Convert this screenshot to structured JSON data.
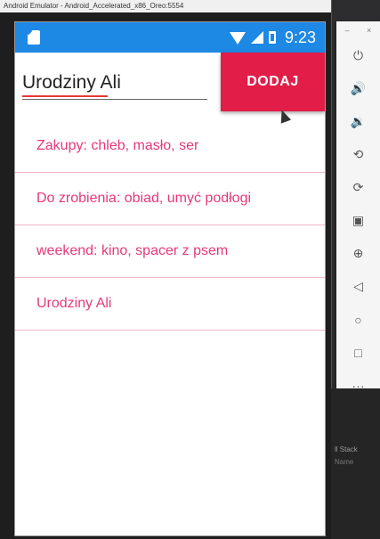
{
  "emulator": {
    "title": "Android Emulator - Android_Accelerated_x86_Oreo:5554"
  },
  "statusbar": {
    "time": "9:23"
  },
  "entry": {
    "value": "Urodziny Ali"
  },
  "add_button": {
    "label": "DODAJ"
  },
  "list": {
    "items": [
      {
        "label": "Zakupy: chleb, masło, ser"
      },
      {
        "label": "Do zrobienia: obiad, umyć podłogi"
      },
      {
        "label": "weekend: kino, spacer z psem"
      },
      {
        "label": "Urodziny Ali"
      }
    ]
  },
  "toolbar": {
    "window_controls": [
      "–",
      "×"
    ],
    "buttons": [
      {
        "icon": "power-icon",
        "glyph": "⏻"
      },
      {
        "icon": "volume-up-icon",
        "glyph": "🔊"
      },
      {
        "icon": "volume-down-icon",
        "glyph": "🔉"
      },
      {
        "icon": "rotate-left-icon",
        "glyph": "⟲"
      },
      {
        "icon": "rotate-right-icon",
        "glyph": "⟳"
      },
      {
        "icon": "camera-icon",
        "glyph": "▣"
      },
      {
        "icon": "zoom-icon",
        "glyph": "⊕"
      },
      {
        "icon": "back-icon",
        "glyph": "◁"
      },
      {
        "icon": "home-icon",
        "glyph": "○"
      },
      {
        "icon": "overview-icon",
        "glyph": "□"
      },
      {
        "icon": "more-icon",
        "glyph": "···"
      }
    ]
  },
  "background_panel": {
    "line1": "ll Stack",
    "line2": "Name"
  },
  "colors": {
    "statusbar": "#1e88e5",
    "accent": "#e11d48",
    "list_text": "#e6397a",
    "divider": "#f2b8c6"
  }
}
